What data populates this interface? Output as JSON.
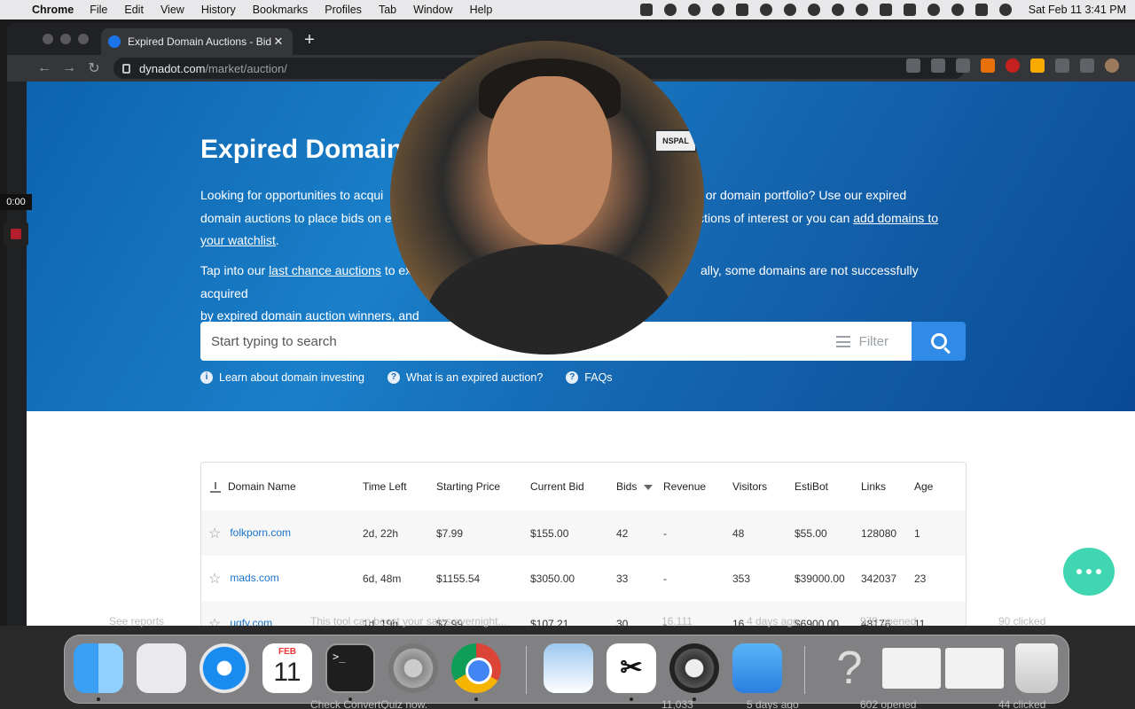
{
  "menubar": {
    "app": "Chrome",
    "menus": [
      "File",
      "Edit",
      "View",
      "History",
      "Bookmarks",
      "Profiles",
      "Tab",
      "Window",
      "Help"
    ],
    "clock": "Sat Feb 11  3:41 PM"
  },
  "browser": {
    "tab_title": "Expired Domain Auctions - Bid",
    "url_domain": "dynadot.com",
    "url_path": "/market/auction/"
  },
  "hero": {
    "title": "Expired Domain",
    "p1_a": "Looking for opportunities to acqui",
    "p1_b": "ess or domain portfolio? Use our expired",
    "p1_c": "domain auctions to place bids on e",
    "p1_d": "uctions of interest or you can",
    "p1_link": "add domains to your watchlist",
    "p2_a": "Tap into our",
    "p2_link": "last chance auctions",
    "p2_b": "to ex",
    "p2_c": "ally, some domains are not successfully acquired",
    "p2_d": "by expired domain auction winners, and"
  },
  "search": {
    "placeholder": "Start typing to search",
    "filter_label": "Filter"
  },
  "help_links": [
    "Learn about domain investing",
    "What is an expired auction?",
    "FAQs"
  ],
  "table": {
    "headers": [
      "Domain Name",
      "Time Left",
      "Starting Price",
      "Current Bid",
      "Bids",
      "Revenue",
      "Visitors",
      "EstiBot",
      "Links",
      "Age"
    ],
    "rows": [
      [
        "folkporn.com",
        "2d, 22h",
        "$7.99",
        "$155.00",
        "42",
        "-",
        "48",
        "$55.00",
        "128080",
        "1"
      ],
      [
        "mads.com",
        "6d, 48m",
        "$1155.54",
        "$3050.00",
        "33",
        "-",
        "353",
        "$39000.00",
        "342037",
        "23"
      ],
      [
        "uqfy.com",
        "1d, 19h",
        "$7.99",
        "$107.21",
        "30",
        "-",
        "16",
        "$6900.00",
        "48176",
        "11"
      ]
    ]
  },
  "recorder": {
    "time": "0:00"
  },
  "webcam": {
    "plate_text": "NSPAL"
  },
  "background": {
    "see_reports": "See reports",
    "row1_text": "This tool can boost your sales overnight...",
    "row1_count": "16,111",
    "row1_time": "4 days ago",
    "row1_opened": "979 opened",
    "row1_clicked": "90 clicked",
    "row2_text": "Check ConvertQuiz now.",
    "row2_count": "11,033",
    "row2_time": "5 days ago",
    "row2_opened": "602 opened",
    "row2_clicked": "44 clicked"
  },
  "dock": {
    "calendar_month": "FEB",
    "calendar_day": "11",
    "terminal_prompt": ">_",
    "capcut_glyph": "✂",
    "help_glyph": "?"
  }
}
